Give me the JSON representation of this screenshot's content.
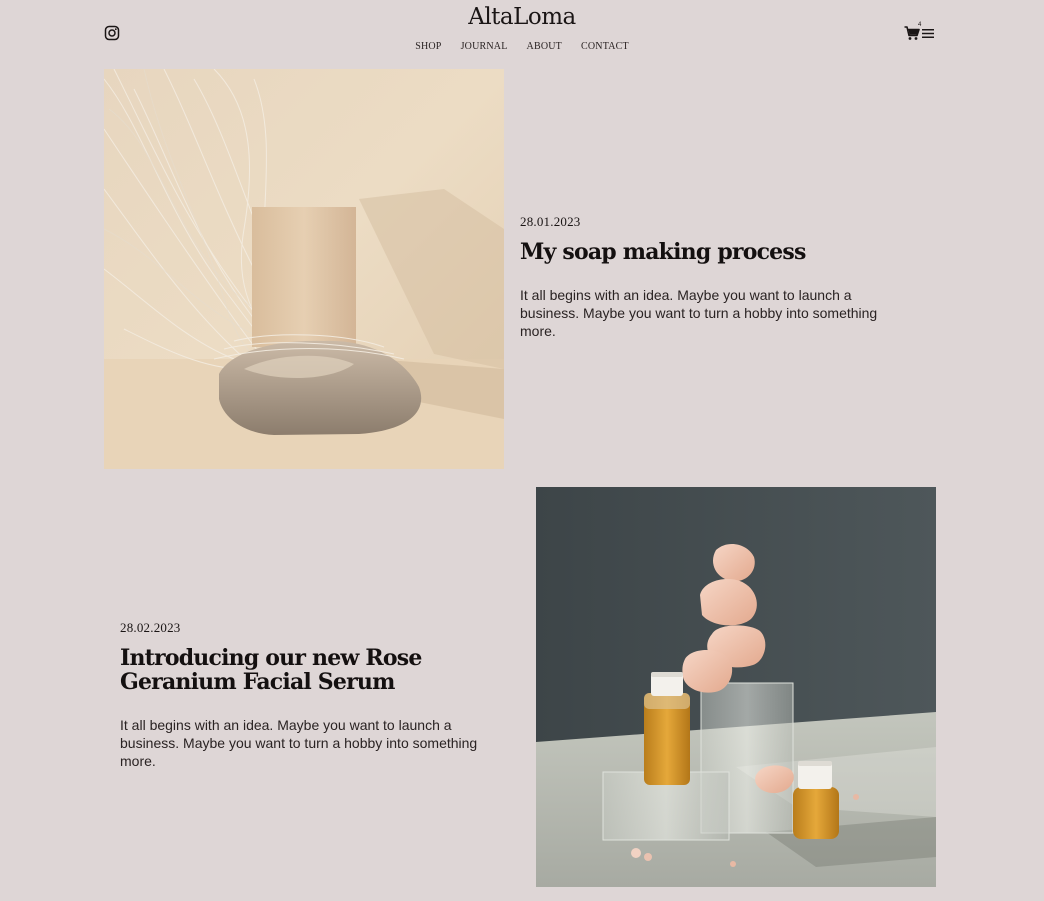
{
  "header": {
    "brand": "AltaLoma",
    "nav": [
      "SHOP",
      "JOURNAL",
      "ABOUT",
      "CONTACT"
    ],
    "cart_count": "4",
    "icons": {
      "social": "instagram-icon",
      "cart": "cart-icon",
      "menu": "hamburger-menu-icon"
    }
  },
  "posts": [
    {
      "date": "28.01.2023",
      "title": "My soap making process",
      "excerpt": "It all begins with an idea. Maybe you want to launch a business. Maybe you want to turn a hobby into something more.",
      "image": "soap bar on rock with dried fibers"
    },
    {
      "date": "28.02.2023",
      "title": "Introducing our new Rose Geranium Facial Serum",
      "excerpt": "It all begins with an idea. Maybe you want to launch a business. Maybe you want to turn a hobby into something more.",
      "image": "serum bottles with pink salt crystals on glass blocks"
    }
  ],
  "colors": {
    "background": "#ded6d6",
    "text": "#1a1515"
  }
}
